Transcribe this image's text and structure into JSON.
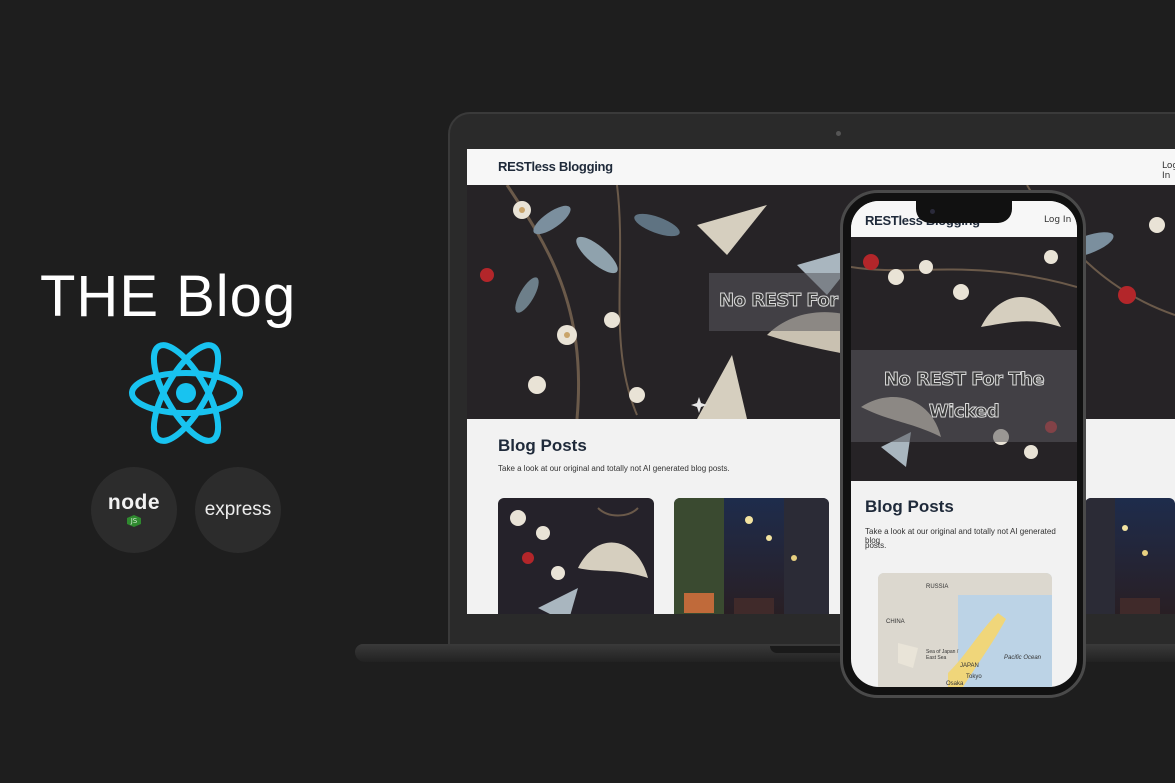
{
  "branding": {
    "title": "THE Blog",
    "react_color": "#18c3f0",
    "node_label": "node",
    "node_sub": "JS",
    "express_label": "express"
  },
  "desktop_site": {
    "brand": "RESTless Blogging",
    "login": "Log In",
    "hero_title": "No REST For The Wicked",
    "hero_title_visible": "No REST For",
    "posts_title": "Blog Posts",
    "posts_subtitle": "Take a look at our original and totally not AI generated blog posts."
  },
  "mobile_site": {
    "brand": "RESTless Blogging",
    "login": "Log In",
    "hero_title_line1": "No REST For The",
    "hero_title_line2": "Wicked",
    "posts_title": "Blog Posts",
    "posts_subtitle_line1": "Take a look at our original and totally not AI generated blog",
    "posts_subtitle_line2": "posts.",
    "map_labels": [
      "RUSSIA",
      "CHINA",
      "Sea of Japan / East Sea",
      "JAPAN",
      "Pacific Ocean",
      "Tokyo",
      "Osaka"
    ]
  },
  "colors": {
    "background": "#1e1e1e",
    "site_nav": "#f7f7f7",
    "brand_text": "#1f2a3a",
    "hero_bg": "#262326"
  }
}
